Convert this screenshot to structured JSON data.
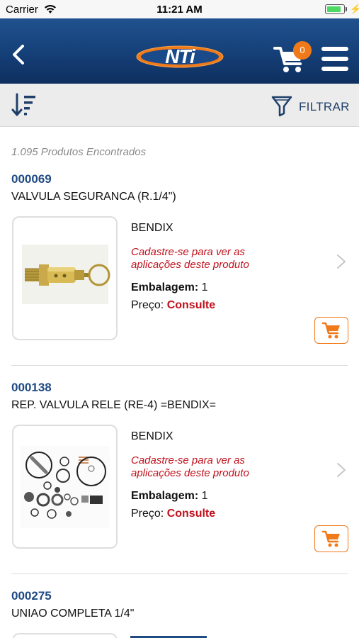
{
  "status_bar": {
    "carrier": "Carrier",
    "time": "11:21 AM",
    "battery_level": 0.85
  },
  "header": {
    "logo_text": "NTi",
    "cart_count": "0"
  },
  "toolbar": {
    "filter_label": "FILTRAR"
  },
  "results": {
    "count_text": "1.095 Produtos Encontrados"
  },
  "products": [
    {
      "code": "000069",
      "name": "VALVULA SEGURANCA (R.1/4\")",
      "brand": "BENDIX",
      "notice": "Cadastre-se para ver as aplicações deste produto",
      "pack_label": "Embalagem:",
      "pack_value": "1",
      "price_label": "Preço:",
      "price_value": "Consulte"
    },
    {
      "code": "000138",
      "name": "REP. VALVULA RELE (RE-4) =BENDIX=",
      "brand": "BENDIX",
      "notice": "Cadastre-se para ver as aplicações deste produto",
      "pack_label": "Embalagem:",
      "pack_value": "1",
      "price_label": "Preço:",
      "price_value": "Consulte"
    },
    {
      "code": "000275",
      "name": "UNIAO COMPLETA 1/4\""
    }
  ],
  "colors": {
    "header_blue": "#153f77",
    "accent_orange": "#f07a1a",
    "code_blue": "#1f4a84",
    "alert_red": "#c0111d"
  },
  "icons": [
    "back-icon",
    "cart-icon",
    "menu-icon",
    "sort-icon",
    "filter-icon",
    "chevron-right-icon",
    "add-to-cart-icon",
    "wifi-icon",
    "battery-icon"
  ]
}
